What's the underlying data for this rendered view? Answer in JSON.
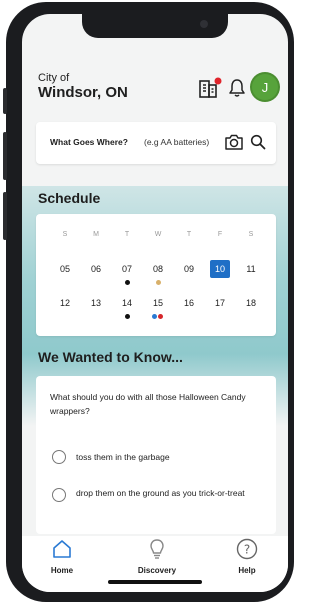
{
  "header": {
    "city_of": "City of",
    "city_name": "Windsor, ON",
    "avatar_initial": "J",
    "notification_badge_color": "#e0242b",
    "avatar_color": "#57a33b"
  },
  "search": {
    "label": "What Goes Where?",
    "placeholder": "(e.g AA batteries)"
  },
  "schedule": {
    "title": "Schedule",
    "weekdays": [
      "S",
      "M",
      "T",
      "W",
      "T",
      "F",
      "S"
    ],
    "weeks": [
      [
        "05",
        "06",
        "07",
        "08",
        "09",
        "10",
        "11"
      ],
      [
        "12",
        "13",
        "14",
        "15",
        "16",
        "17",
        "18"
      ]
    ],
    "selected_day": "10",
    "accent_color": "#1f6fc6"
  },
  "wanted": {
    "title": "We Wanted to Know...",
    "question": "What should you do with all those Halloween Candy wrappers?",
    "options": [
      "toss them in the garbage",
      "drop them on the ground as you trick-or-treat"
    ]
  },
  "nav": {
    "items": [
      {
        "label": "Home",
        "icon": "home-icon"
      },
      {
        "label": "Discovery",
        "icon": "lightbulb-icon"
      },
      {
        "label": "Help",
        "icon": "help-icon"
      }
    ]
  }
}
